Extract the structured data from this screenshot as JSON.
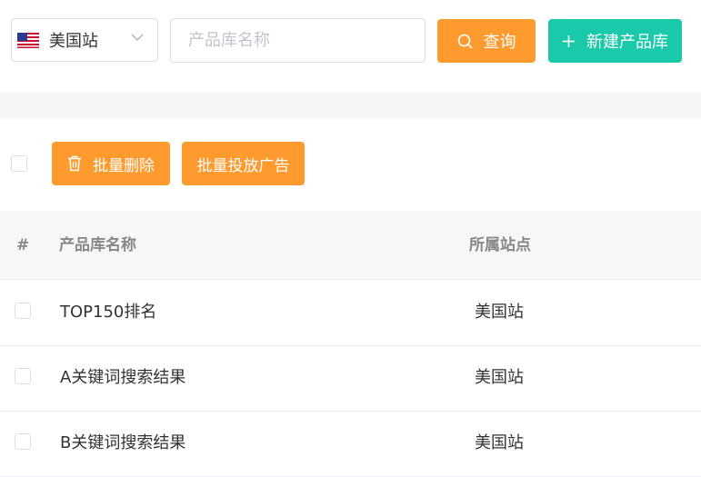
{
  "toolbar": {
    "site_select": {
      "value": "美国站",
      "flag_icon": "us-flag-icon",
      "arrow_icon": "chevron-down-icon"
    },
    "search": {
      "placeholder": "产品库名称",
      "value": ""
    },
    "query_button": {
      "label": "查询",
      "icon": "search-icon"
    },
    "create_button": {
      "label": "新建产品库",
      "icon": "plus-icon"
    }
  },
  "bulk_actions": {
    "delete_button": {
      "label": "批量删除",
      "icon": "trash-icon"
    },
    "ad_button": {
      "label": "批量投放广告"
    }
  },
  "table": {
    "columns": [
      "#",
      "产品库名称",
      "所属站点"
    ],
    "rows": [
      {
        "name": "TOP150排名",
        "site": "美国站"
      },
      {
        "name": "A关键词搜索结果",
        "site": "美国站"
      },
      {
        "name": "B关键词搜索结果",
        "site": "美国站"
      }
    ]
  },
  "colors": {
    "primary_orange": "#ff9a2e",
    "primary_green": "#19c9a9",
    "header_bg": "#f7f7f7",
    "border": "#dcdfe6"
  }
}
